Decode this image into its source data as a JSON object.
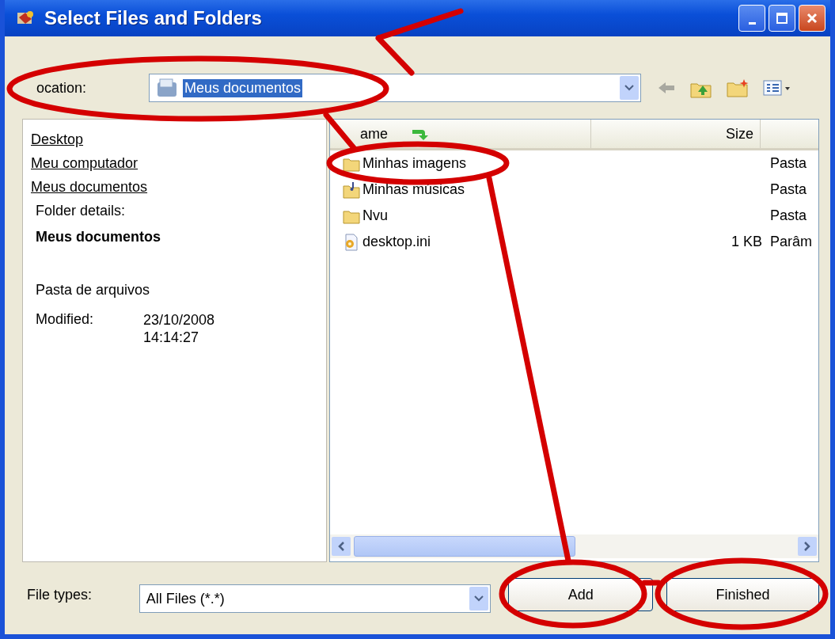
{
  "window": {
    "title": "Select Files and Folders"
  },
  "location": {
    "label": "ocation:",
    "value": "Meus documentos",
    "selected": true
  },
  "places": [
    {
      "label": "Desktop"
    },
    {
      "label": "Meu computador"
    },
    {
      "label": "Meus documentos"
    }
  ],
  "details": {
    "heading": "Folder details:",
    "name": "Meus documentos",
    "type": "Pasta de arquivos",
    "modified_label": "Modified:",
    "modified_date": "23/10/2008",
    "modified_time": "14:14:27"
  },
  "file_list": {
    "columns": [
      "ame",
      "Size"
    ],
    "rows": [
      {
        "kind": "folder",
        "name": "Minhas imagens",
        "column_3": "Pasta"
      },
      {
        "kind": "music-folder",
        "name": "Minhas músicas",
        "column_3": "Pasta"
      },
      {
        "kind": "folder",
        "name": "Nvu",
        "column_3": "Pasta"
      },
      {
        "kind": "file",
        "name": "desktop.ini",
        "size": "1 KB",
        "column_3": "Parâm"
      }
    ]
  },
  "file_types": {
    "label": "File types:",
    "value": "All Files (*.*)"
  },
  "buttons": [
    "Add",
    "Finished"
  ]
}
